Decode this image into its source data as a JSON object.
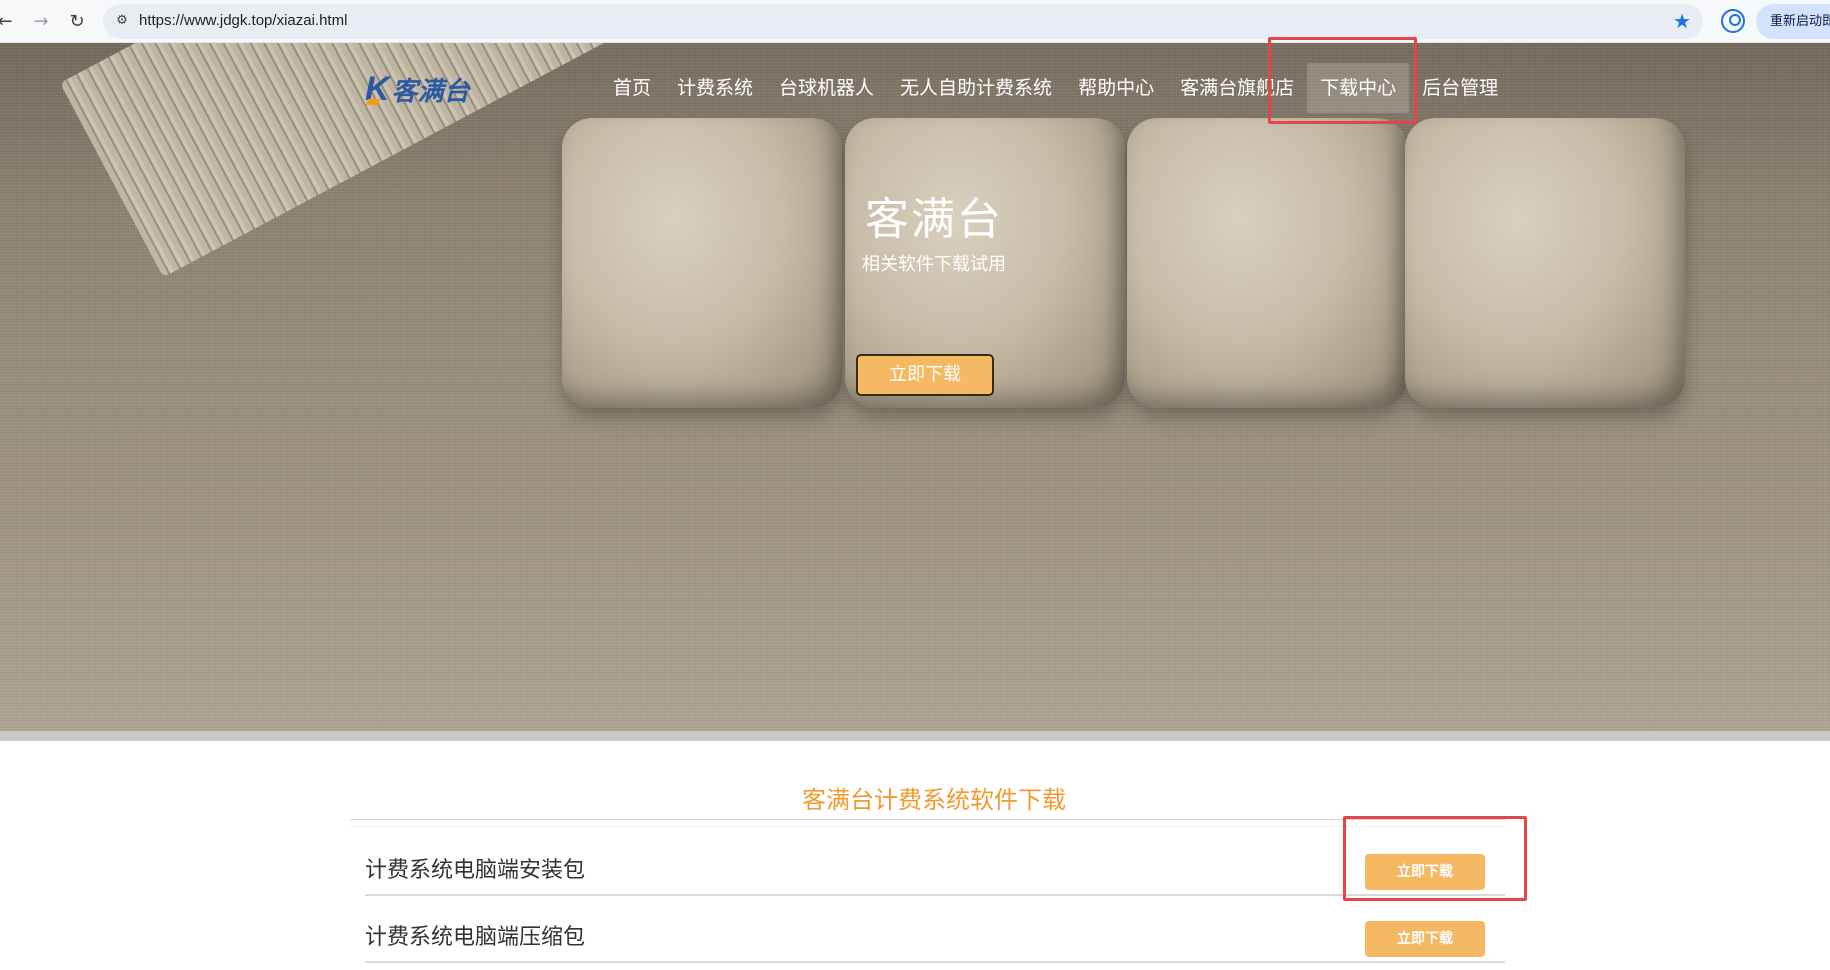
{
  "browser": {
    "url": "https://www.jdgk.top/xiazai.html",
    "relaunch_label": "重新启动即",
    "back_icon": "←",
    "forward_icon": "→",
    "reload_icon": "↻",
    "site_info_icon": "⚙",
    "star_icon": "★"
  },
  "logo": {
    "mark": "K",
    "text": "客满台"
  },
  "nav": {
    "items": [
      {
        "label": "首页"
      },
      {
        "label": "计费系统"
      },
      {
        "label": "台球机器人"
      },
      {
        "label": "无人自助计费系统"
      },
      {
        "label": "帮助中心"
      },
      {
        "label": "客满台旗舰店"
      },
      {
        "label": "下载中心",
        "active": true
      },
      {
        "label": "后台管理"
      }
    ]
  },
  "hero": {
    "title": "客满台",
    "subtitle": "相关软件下载试用",
    "button_label": "立即下载"
  },
  "downloads": {
    "section_title": "客满台计费系统软件下载",
    "items": [
      {
        "name": "计费系统电脑端安装包",
        "button_label": "立即下载"
      },
      {
        "name": "计费系统电脑端压缩包",
        "button_label": "立即下载"
      }
    ]
  },
  "colors": {
    "accent_orange": "#f39a2e",
    "button_fill": "#f4b862",
    "highlight_red": "#e8434a",
    "logo_blue": "#2c5aa0"
  }
}
